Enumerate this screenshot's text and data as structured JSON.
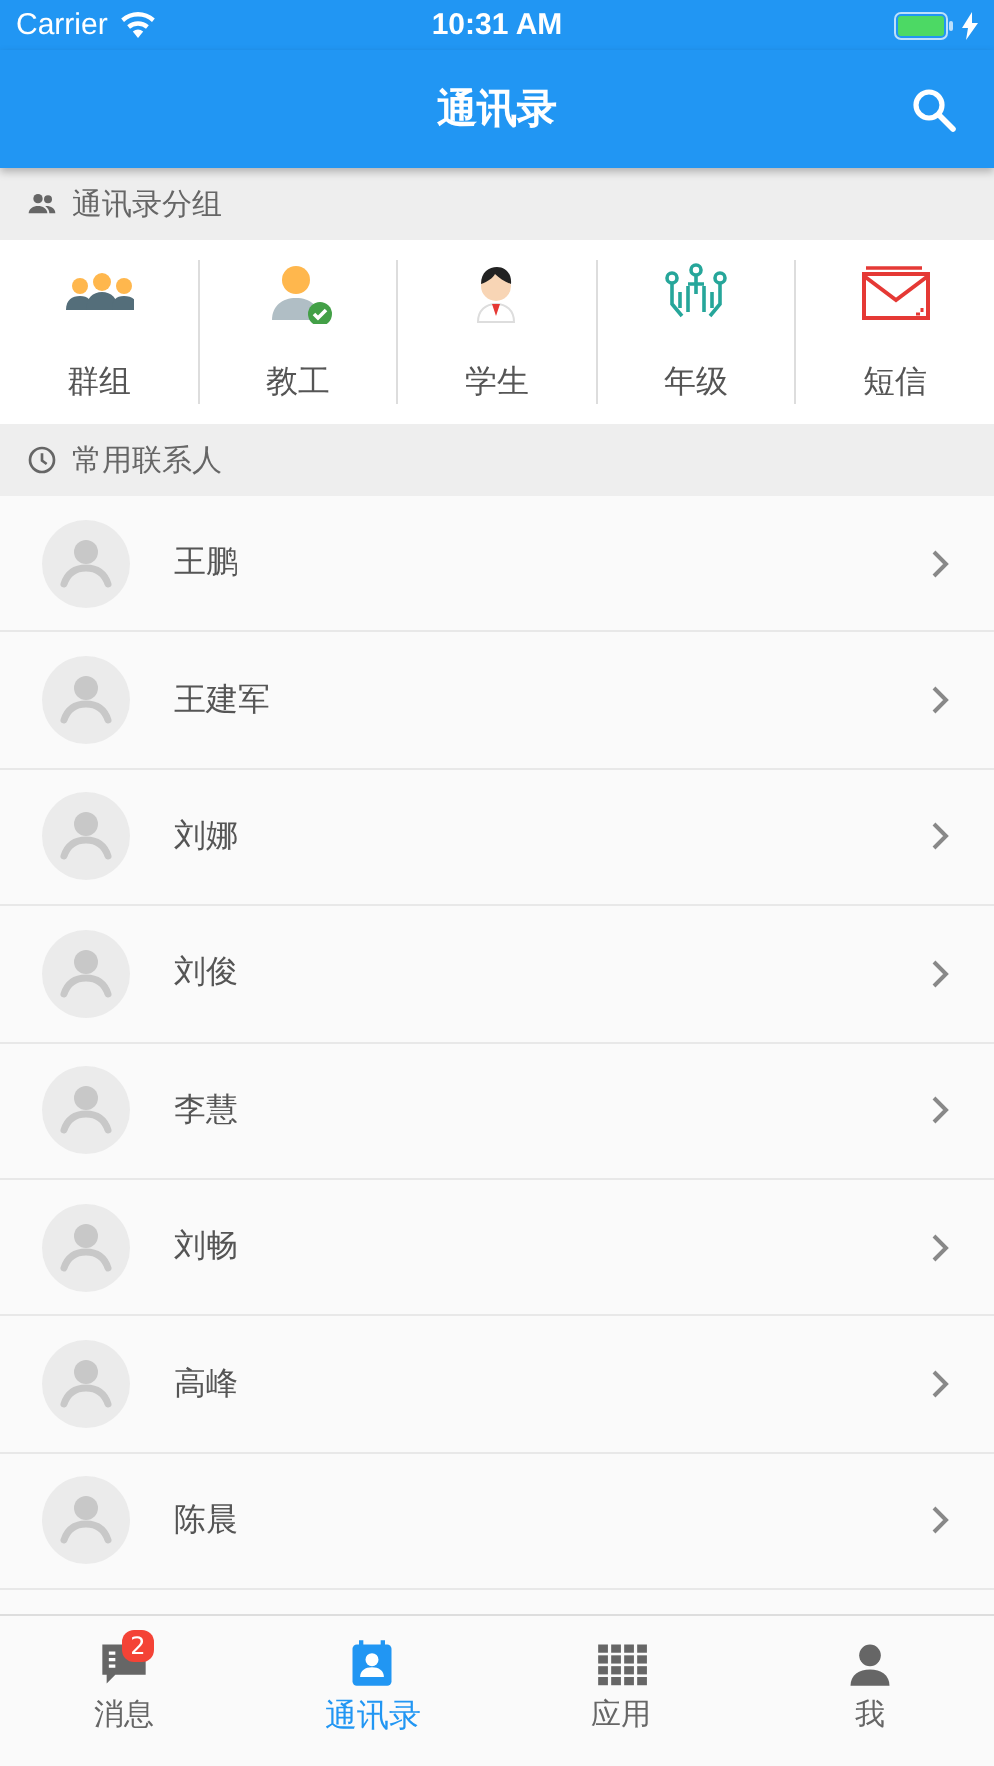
{
  "status_bar": {
    "carrier": "Carrier",
    "time": "10:31 AM"
  },
  "header": {
    "title": "通讯录"
  },
  "groups_section": {
    "title": "通讯录分组",
    "items": [
      {
        "kind": "group",
        "label": "群组"
      },
      {
        "kind": "staff",
        "label": "教工"
      },
      {
        "kind": "student",
        "label": "学生"
      },
      {
        "kind": "grade",
        "label": "年级"
      },
      {
        "kind": "sms",
        "label": "短信"
      }
    ]
  },
  "contacts_section": {
    "title": "常用联系人",
    "contacts": [
      {
        "name": "王鹏"
      },
      {
        "name": "王建军"
      },
      {
        "name": "刘娜"
      },
      {
        "name": "刘俊"
      },
      {
        "name": "李慧"
      },
      {
        "name": "刘畅"
      },
      {
        "name": "高峰"
      },
      {
        "name": "陈晨"
      }
    ]
  },
  "tab_bar": [
    {
      "kind": "messages",
      "label": "消息",
      "badge": "2",
      "selected": false
    },
    {
      "kind": "contacts",
      "label": "通讯录",
      "selected": true
    },
    {
      "kind": "apps",
      "label": "应用",
      "selected": false
    },
    {
      "kind": "me",
      "label": "我",
      "selected": false
    }
  ]
}
